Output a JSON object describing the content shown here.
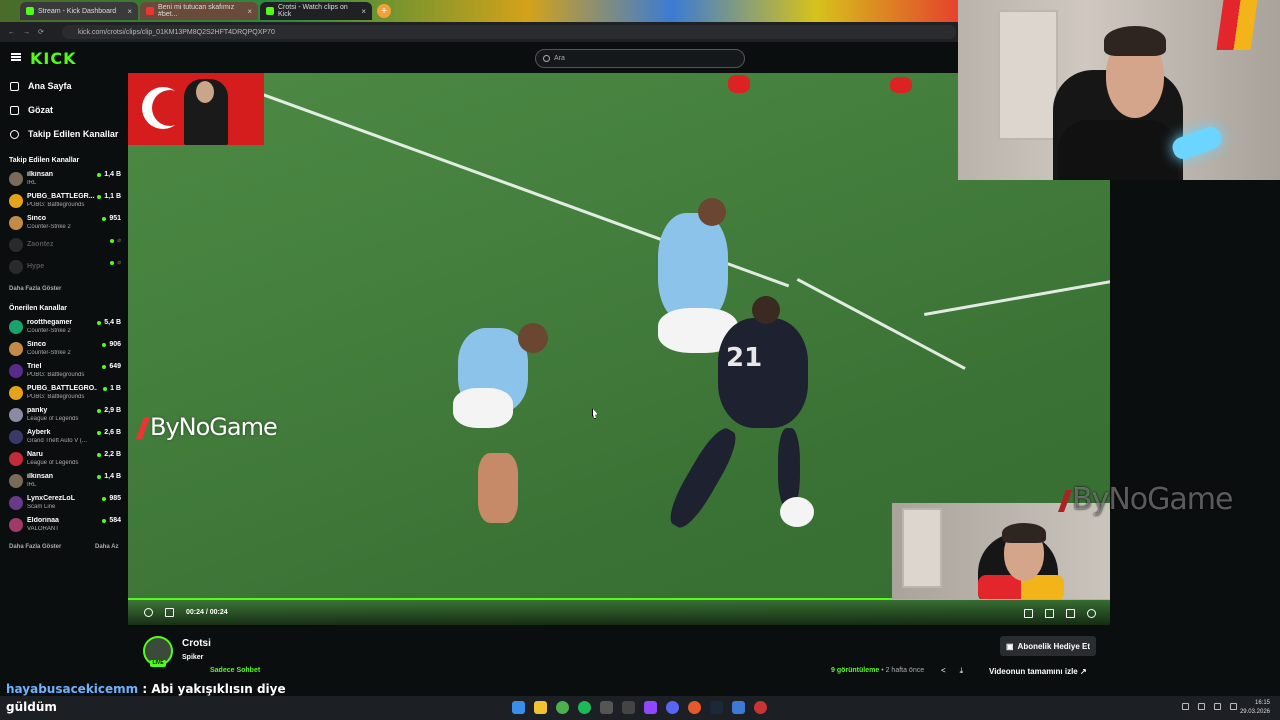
{
  "browser": {
    "tabs": [
      {
        "label": "Stream - Kick Dashboard",
        "color": "#53fc18"
      },
      {
        "label": "Beni mi tutucan skafımız #bet...",
        "color": "#e33"
      },
      {
        "label": "Crotsi - Watch clips on Kick",
        "color": "#53fc18"
      }
    ],
    "url": "kick.com/crotsi/clips/clip_01KM13PM8Q2S2HFT4DRQPQXP70"
  },
  "header": {
    "logo": "KICK",
    "search_placeholder": "Ara"
  },
  "sidebar": {
    "nav": [
      {
        "label": "Ana Sayfa",
        "icon": "home-icon"
      },
      {
        "label": "Gözat",
        "icon": "browse-icon"
      },
      {
        "label": "Takip Edilen Kanallar",
        "icon": "heart-icon"
      }
    ],
    "followed_title": "Takip Edilen Kanallar",
    "followed": [
      {
        "name": "ilkinsan",
        "game": "IRL",
        "viewers": "1,4 B",
        "color": "#7a6a5a"
      },
      {
        "name": "PUBG_BATTLEGR...",
        "game": "PUBG: Battlegrounds",
        "viewers": "1,1 B",
        "color": "#e5a21b"
      },
      {
        "name": "Sinco",
        "game": "Counter-Strike 2",
        "viewers": "951",
        "color": "#c48a4a"
      },
      {
        "name": "Zaontez",
        "game": "",
        "viewers": "",
        "color": "#555"
      },
      {
        "name": "Hype",
        "game": "",
        "viewers": "",
        "color": "#555"
      }
    ],
    "followed_more": "Daha Fazla Göster",
    "recommended_title": "Önerilen Kanallar",
    "recommended": [
      {
        "name": "rootthegamer",
        "game": "Counter-Strike 2",
        "viewers": "5,4 B",
        "color": "#1aa36c"
      },
      {
        "name": "Sinco",
        "game": "Counter-Strike 2",
        "viewers": "906",
        "color": "#c48a4a"
      },
      {
        "name": "Triel",
        "game": "PUBG: Battlegrounds",
        "viewers": "649",
        "color": "#5a2a8a"
      },
      {
        "name": "PUBG_BATTLEGRO...",
        "game": "PUBG: Battlegrounds",
        "viewers": "1 B",
        "color": "#e5a21b"
      },
      {
        "name": "panky",
        "game": "League of Legends",
        "viewers": "2,9 B",
        "color": "#8a8aa0"
      },
      {
        "name": "Ayberk",
        "game": "Grand Theft Auto V (...",
        "viewers": "2,6 B",
        "color": "#3a3a6a"
      },
      {
        "name": "Naru",
        "game": "League of Legends",
        "viewers": "2,2 B",
        "color": "#c32a3a"
      },
      {
        "name": "ilkinsan",
        "game": "IRL",
        "viewers": "1,4 B",
        "color": "#7a6a5a"
      },
      {
        "name": "LynxCerezLoL",
        "game": "Scam Line",
        "viewers": "985",
        "color": "#6a3a8a"
      },
      {
        "name": "Eldorinaa",
        "game": "VALORANT",
        "viewers": "584",
        "color": "#a03a6a"
      }
    ],
    "recommended_more": "Daha Fazla Göster",
    "recommended_less": "Daha Az"
  },
  "video": {
    "watermark": "ByNoGame",
    "time": "00:24 / 00:24",
    "progress": 1.0,
    "jersey_number": "21"
  },
  "channel": {
    "name": "Crotsi",
    "title": "Spiker",
    "category": "Sadece Sohbet",
    "live_badge": "LIVE",
    "gift_button": "Abonelik Hediye Et",
    "views": "9 görüntüleme",
    "age": "• 2 hafta önce",
    "full_video": "Videonun tamamını izle"
  },
  "overlay": {
    "user": "hayabusacekicemm",
    "message": ": Abi yakışıklısın diye",
    "extra": "güldüm"
  },
  "taskbar": {
    "time": "16:15",
    "date": "29.03.2026"
  },
  "colors": {
    "accent": "#53fc18",
    "background": "#0b0e0f"
  }
}
